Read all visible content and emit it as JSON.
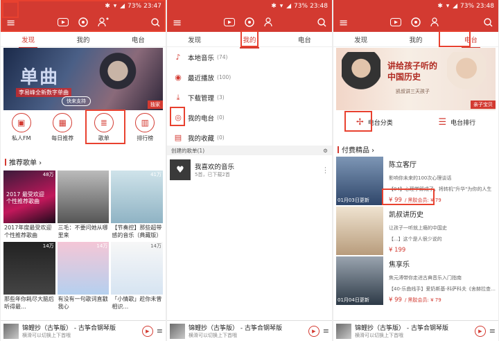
{
  "status": [
    {
      "battery": "73%",
      "time": "23:47"
    },
    {
      "battery": "73%",
      "time": "23:48"
    },
    {
      "battery": "73%",
      "time": "23:48"
    }
  ],
  "tabs": {
    "discover": "发现",
    "mine": "我的",
    "radio": "电台"
  },
  "p1": {
    "banner": {
      "text": "单曲",
      "subline": "李易峰全新数字单曲",
      "pill": "快来支持",
      "tag": "独家"
    },
    "quick": [
      "私人FM",
      "每日推荐",
      "歌单",
      "排行榜"
    ],
    "section_title": "推荐歌单",
    "cards": [
      {
        "count": "48万",
        "caption": "2017年度最受欢迎个性推荐歌曲",
        "overlay": "2017 最受欢迎个性推荐歌曲"
      },
      {
        "count": "",
        "caption": "三毛：不要问她从哪里来"
      },
      {
        "count": "41万",
        "caption": "【节奏控】那些超带感的音乐（典藏版）"
      },
      {
        "count": "14万",
        "caption": "那些年你耗尽大脑后听得最…"
      },
      {
        "count": "14万",
        "caption": "有没有一句歌词直戳我心"
      },
      {
        "count": "14万",
        "caption": "「小情歌」趁你未曾相识…"
      }
    ]
  },
  "p2": {
    "items": [
      {
        "label": "本地音乐",
        "count": "(74)"
      },
      {
        "label": "最近播放",
        "count": "(100)"
      },
      {
        "label": "下载管理",
        "count": "(3)"
      },
      {
        "label": "我的电台",
        "count": "(0)"
      },
      {
        "label": "我的收藏",
        "count": "(0)"
      }
    ],
    "created_header": "创建的歌单(1)",
    "playlist": {
      "title": "我喜欢的音乐",
      "sub": "5首，已下载2首"
    }
  },
  "p3": {
    "banner": {
      "title_l1": "讲给孩子听的",
      "title_l2": "中国历史",
      "sub": "凯叔讲三天孩子",
      "tag": "亲子宝贝"
    },
    "quick": [
      "电台分类",
      "电台排行"
    ],
    "section_title": "付费精品",
    "items": [
      {
        "name": "陈立客厅",
        "desc": "影响你未来的100次心理谈话",
        "ep": "【04】心理学即成了，将转机\"升华\"为你的人生",
        "price": "¥ 99",
        "vip": "/ 黑胶会员: ¥ 79",
        "date": "01月03日更新"
      },
      {
        "name": "凯叔讲历史",
        "desc": "让孩子一听就上瘾的中国史",
        "ep": "【...】这个是人很少说的",
        "price": "¥ 199",
        "vip": "",
        "date": ""
      },
      {
        "name": "焦享乐",
        "desc": "焦元溥带你走进古典音乐入门指南",
        "ep": "【40-乐曲线手】爱奶斯基-科萨科夫《舍赫拉查…",
        "price": "¥ 99",
        "vip": "/ 黑胶会员: ¥ 79",
        "date": "01月04日更新"
      }
    ]
  },
  "player": {
    "title": "锦鲤抄（古筝版） - 古筝合钢琴版",
    "hint": "横滑可以切换上下首哦"
  }
}
